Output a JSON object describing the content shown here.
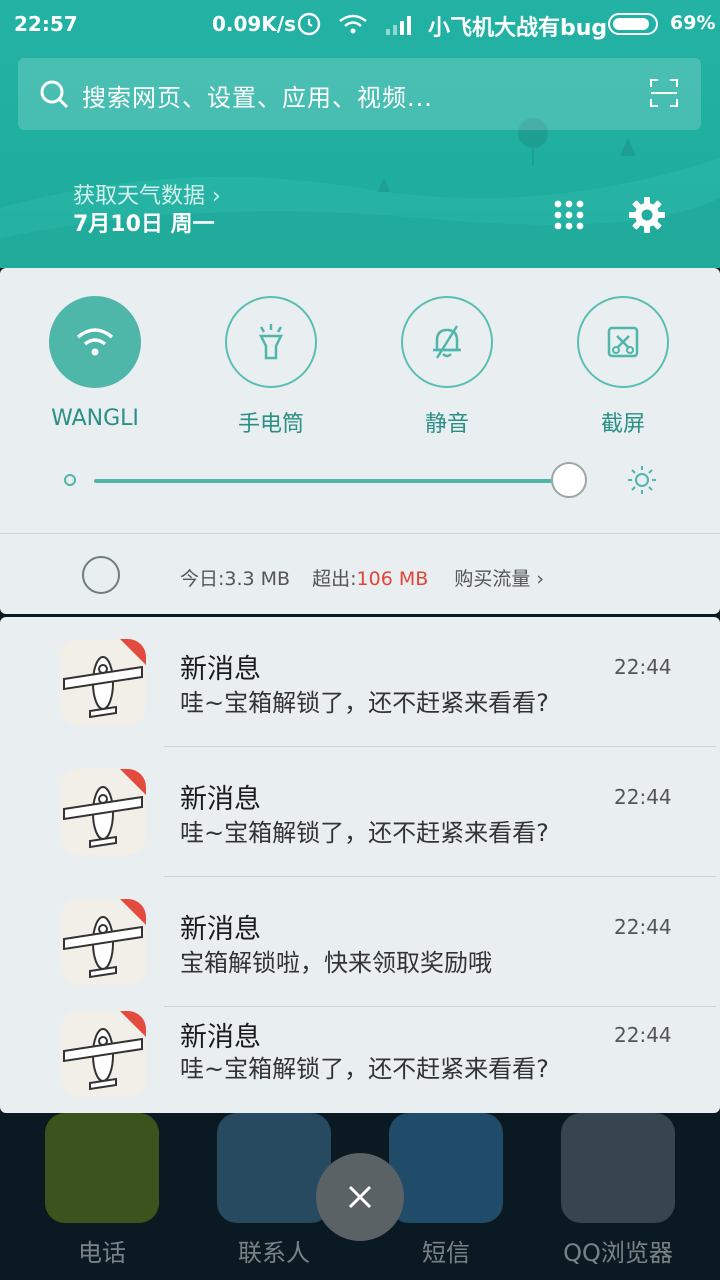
{
  "status_bar": {
    "time": "22:57",
    "speed": "0.09K/s",
    "carrier": "小飞机大战有bug",
    "battery": "69%"
  },
  "search": {
    "placeholder": "搜索网页、设置、应用、视频..."
  },
  "weather": {
    "label": "获取天气数据 ›",
    "date": "7月10日 周一"
  },
  "toggles": [
    {
      "label": "WANGLI",
      "icon": "wifi-icon",
      "active": true
    },
    {
      "label": "手电筒",
      "icon": "flashlight-icon",
      "active": false
    },
    {
      "label": "静音",
      "icon": "mute-bell-icon",
      "active": false
    },
    {
      "label": "截屏",
      "icon": "screenshot-icon",
      "active": false
    }
  ],
  "brightness": {
    "level": 0.95
  },
  "data_usage": {
    "today": "今日:3.3 MB",
    "over_label": "超出:",
    "over_value": "106 MB",
    "buy": "购买流量 ›"
  },
  "notifications": [
    {
      "title": "新消息",
      "body": "哇~宝箱解锁了，还不赶紧来看看?",
      "time": "22:44"
    },
    {
      "title": "新消息",
      "body": "哇~宝箱解锁了，还不赶紧来看看?",
      "time": "22:44"
    },
    {
      "title": "新消息",
      "body": "宝箱解锁啦，快来领取奖励哦",
      "time": "22:44"
    },
    {
      "title": "新消息",
      "body": "哇~宝箱解锁了，还不赶紧来看看?",
      "time": "22:44"
    }
  ],
  "dock": [
    "电话",
    "联系人",
    "短信",
    "QQ浏览器"
  ],
  "colors": {
    "accent": "#23b2a4",
    "over": "#e0453b"
  }
}
